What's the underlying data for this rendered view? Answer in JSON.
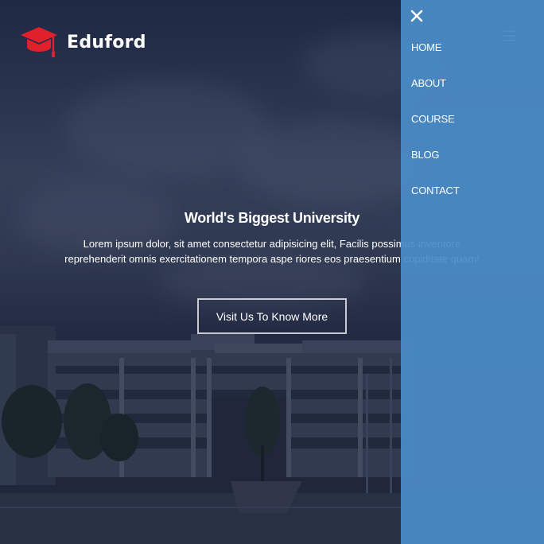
{
  "header": {
    "brand": "Eduford",
    "logo_icon": "graduation-cap-icon",
    "menu_icon": "hamburger-menu-icon"
  },
  "hero": {
    "title": "World's Biggest University",
    "text": "Lorem ipsum dolor, sit amet consectetur adipisicing elit, Facilis possimus inventore reprehenderit omnis exercitationem tempora aspe riores eos praesentium cupiditate quam!",
    "button_label": "Visit Us To Know More"
  },
  "side_menu": {
    "close_icon": "close-icon",
    "items": [
      {
        "label": "HOME"
      },
      {
        "label": "ABOUT"
      },
      {
        "label": "COURSE"
      },
      {
        "label": "BLOG"
      },
      {
        "label": "CONTACT"
      }
    ]
  },
  "colors": {
    "brand_accent": "#e0202a",
    "menu_background": "#4a8cc8",
    "hero_overlay": "#1e2740"
  }
}
